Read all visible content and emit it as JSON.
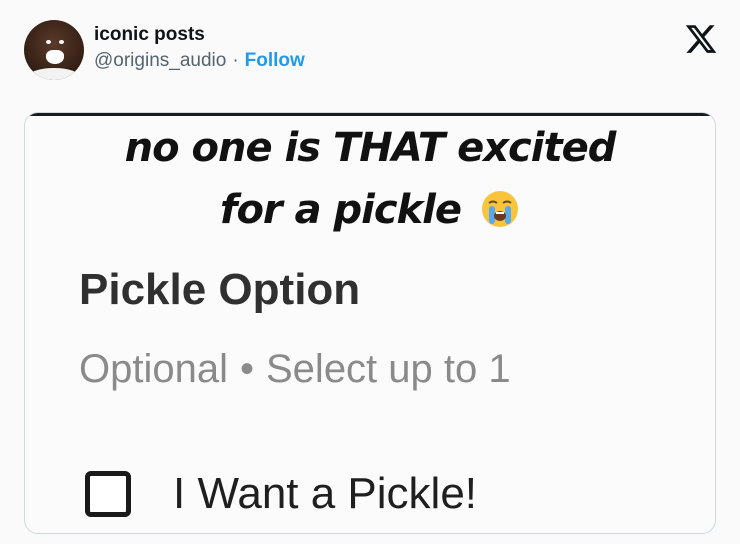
{
  "tweet": {
    "display_name": "iconic posts",
    "handle": "@origins_audio",
    "separator": "·",
    "follow_label": "Follow"
  },
  "media": {
    "caption_line1": "no one is THAT excited",
    "caption_line2": "for a pickle",
    "caption_emoji": "loudly-crying-face-icon",
    "option_title": "Pickle Option",
    "option_optional": "Optional",
    "option_bullet": "•",
    "option_limit": "Select up to 1",
    "checkbox_label": "I Want a Pickle!",
    "checkbox_checked": false
  },
  "icons": {
    "brand": "x-logo-icon",
    "avatar": "avatar"
  },
  "colors": {
    "follow": "#1d9bf0",
    "handle": "#536471",
    "name": "#0f1419",
    "subtext": "#8a8a8a"
  }
}
